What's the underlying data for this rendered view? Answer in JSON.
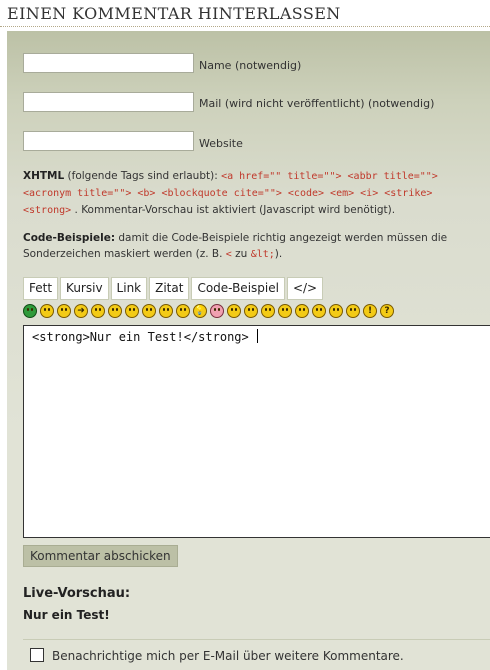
{
  "heading": "Einen Kommentar hinterlassen",
  "form": {
    "name_label": "Name (notwendig)",
    "mail_label": "Mail (wird nicht veröffentlicht) (notwendig)",
    "website_label": "Website"
  },
  "xhtml": {
    "label": "XHTML",
    "intro": "(folgende Tags sind erlaubt):",
    "tags_line1": "<a href=\"\" title=\"\"> <abbr title=\"\">",
    "tags_line2": "<acronym title=\"\"> <b> <blockquote cite=\"\"> <code> <em> <i> <strike>",
    "tags_line3": "<strong>",
    "outro": ". Kommentar-Vorschau ist aktiviert (Javascript wird benötigt)."
  },
  "code_examples": {
    "label": "Code-Beispiele:",
    "text1": "damit die Code-Beispiele richtig angezeigt werden müssen die",
    "text2": "Sonderzeichen maskiert werden (z. B.",
    "lt": "<",
    "zu": "zu",
    "lt_entity": "&lt;",
    "end": ")."
  },
  "toolbar": {
    "buttons": [
      "Fett",
      "Kursiv",
      "Link",
      "Zitat",
      "Code-Beispiel",
      "</>"
    ]
  },
  "smilies": [
    {
      "icon": "grin-icon",
      "glyph": "",
      "variant": "green"
    },
    {
      "icon": "confused-icon",
      "glyph": ""
    },
    {
      "icon": "twisted-icon",
      "glyph": ""
    },
    {
      "icon": "arrow-icon",
      "glyph": "➜"
    },
    {
      "icon": "eek-icon",
      "glyph": ""
    },
    {
      "icon": "biggrin-icon",
      "glyph": ""
    },
    {
      "icon": "smile-icon",
      "glyph": ""
    },
    {
      "icon": "cool-icon",
      "glyph": ""
    },
    {
      "icon": "evil-icon",
      "glyph": ""
    },
    {
      "icon": "lol-icon",
      "glyph": ""
    },
    {
      "icon": "idea-icon",
      "glyph": "💡"
    },
    {
      "icon": "redface-icon",
      "glyph": "",
      "variant": "pink"
    },
    {
      "icon": "razz-icon",
      "glyph": ""
    },
    {
      "icon": "rolleyes-icon",
      "glyph": ""
    },
    {
      "icon": "wink-icon",
      "glyph": ""
    },
    {
      "icon": "neutral-icon",
      "glyph": ""
    },
    {
      "icon": "cry-icon",
      "glyph": ""
    },
    {
      "icon": "mad-icon",
      "glyph": ""
    },
    {
      "icon": "surprised-icon",
      "glyph": ""
    },
    {
      "icon": "sad-icon",
      "glyph": ""
    },
    {
      "icon": "exclaim-icon",
      "glyph": "!"
    },
    {
      "icon": "question-icon",
      "glyph": "?"
    }
  ],
  "comment_text": "<strong>Nur ein Test!</strong>",
  "submit_label": "Kommentar abschicken",
  "live_preview": {
    "title": "Live-Vorschau:",
    "content": "Nur ein Test!"
  },
  "notify_label": "Benachrichtige mich per E-Mail über weitere Kommentare.",
  "colors": {
    "panel": "#cdd1bb",
    "code_red": "#c0392b",
    "submit_bg": "#bcc0a6"
  }
}
